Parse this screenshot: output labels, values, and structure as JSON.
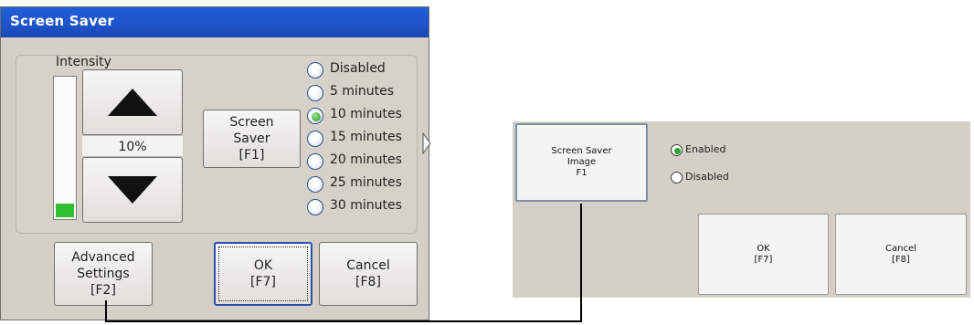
{
  "left_dialog": {
    "title": "Screen Saver",
    "intensity_label": "Intensity",
    "intensity_value": "10%",
    "intensity_level_percent": 10,
    "screen_saver_button": "Screen\nSaver\n[F1]",
    "timeout_options": [
      "Disabled",
      "5 minutes",
      "10 minutes",
      "15 minutes",
      "20 minutes",
      "25 minutes",
      "30 minutes"
    ],
    "selected_timeout": "10 minutes",
    "advanced_button": "Advanced\nSettings\n[F2]",
    "ok_button": "OK\n[F7]",
    "cancel_button": "Cancel\n[F8]"
  },
  "right_panel": {
    "image_button": "Screen Saver\nImage\nF1",
    "options": [
      "Enabled",
      "Disabled"
    ],
    "selected_option": "Enabled",
    "ok_button": "OK\n[F7]",
    "cancel_button": "Cancel\n[F8]"
  },
  "colors": {
    "title_bar": "#1f54c9",
    "dialog_bg": "#d4d0c8",
    "selected_radio": "#2aa62a",
    "intensity_fill": "#2fbf2f"
  }
}
